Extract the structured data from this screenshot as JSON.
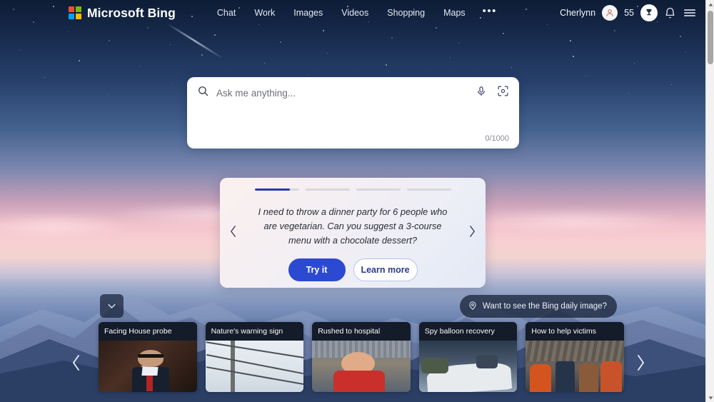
{
  "header": {
    "brand": "Microsoft Bing",
    "logo_icon": "microsoft-logo-icon",
    "logo_colors": [
      "#f25022",
      "#7fba00",
      "#00a4ef",
      "#ffb900"
    ],
    "nav": [
      {
        "label": "Chat"
      },
      {
        "label": "Work"
      },
      {
        "label": "Images"
      },
      {
        "label": "Videos"
      },
      {
        "label": "Shopping"
      },
      {
        "label": "Maps"
      }
    ],
    "overflow_label": "•••",
    "user": {
      "name": "Cherlynn",
      "avatar_icon": "user-avatar-icon",
      "points": "55",
      "rewards_icon": "rewards-trophy-icon",
      "notifications_icon": "bell-icon",
      "menu_icon": "hamburger-menu-icon"
    }
  },
  "search": {
    "placeholder": "Ask me anything...",
    "value": "",
    "search_icon": "search-icon",
    "mic_icon": "microphone-icon",
    "visual_icon": "visual-search-icon",
    "counter": "0/1000"
  },
  "suggestion": {
    "prompt": "I need to throw a dinner party for 6 people who are vegetarian. Can you suggest a 3-course menu with a chocolate dessert?",
    "try_label": "Try it",
    "learn_label": "Learn more",
    "prev_icon": "chevron-left-icon",
    "next_icon": "chevron-right-icon",
    "progress": [
      80,
      0,
      0,
      0
    ],
    "accent_color": "#2b39a8"
  },
  "bottom": {
    "collapse_icon": "chevron-down-icon",
    "daily_image": {
      "icon": "info-location-icon",
      "label": "Want to see the Bing daily image?"
    },
    "prev_icon": "chevron-left-icon",
    "next_icon": "chevron-right-icon",
    "cards": [
      {
        "title": "Facing House probe"
      },
      {
        "title": "Nature's warning sign"
      },
      {
        "title": "Rushed to hospital"
      },
      {
        "title": "Spy balloon recovery"
      },
      {
        "title": "How to help victims"
      }
    ]
  },
  "scrollbar": {
    "up_icon": "scroll-up-arrow-icon",
    "down_icon": "scroll-down-arrow-icon"
  }
}
